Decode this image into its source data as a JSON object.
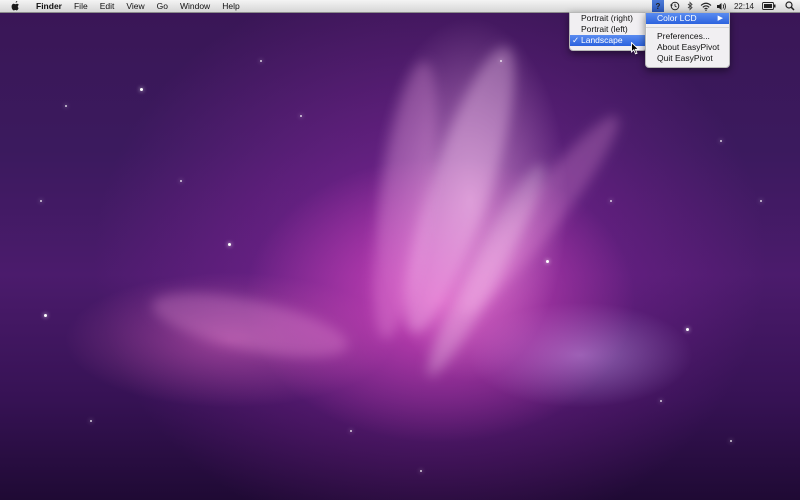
{
  "menubar": {
    "apple_icon": "apple-logo-icon",
    "app_name": "Finder",
    "items": [
      "File",
      "Edit",
      "View",
      "Go",
      "Window",
      "Help"
    ],
    "status": {
      "icons": [
        "easypivot-icon",
        "time-machine-icon",
        "bluetooth-icon",
        "wifi-icon",
        "volume-icon"
      ],
      "clock": "22:14",
      "battery_icon": "battery-icon",
      "spotlight_icon": "spotlight-search-icon",
      "easypivot_glyph": "?"
    }
  },
  "easypivot_menu": {
    "items": [
      {
        "label": "Color LCD",
        "has_submenu": true,
        "highlighted": true
      },
      {
        "label": "Preferences..."
      },
      {
        "label": "About EasyPivot"
      },
      {
        "label": "Quit EasyPivot"
      }
    ]
  },
  "orientation_submenu": {
    "items": [
      {
        "label": "Portrait (right)",
        "checked": false
      },
      {
        "label": "Portrait (left)",
        "checked": false
      },
      {
        "label": "Landscape",
        "checked": true,
        "highlighted": true
      }
    ],
    "check_glyph": "✓"
  },
  "colors": {
    "menu_highlight": "#3a6fe4",
    "wallpaper_primary": "#c43aa8",
    "wallpaper_dark": "#2a0f3f"
  }
}
